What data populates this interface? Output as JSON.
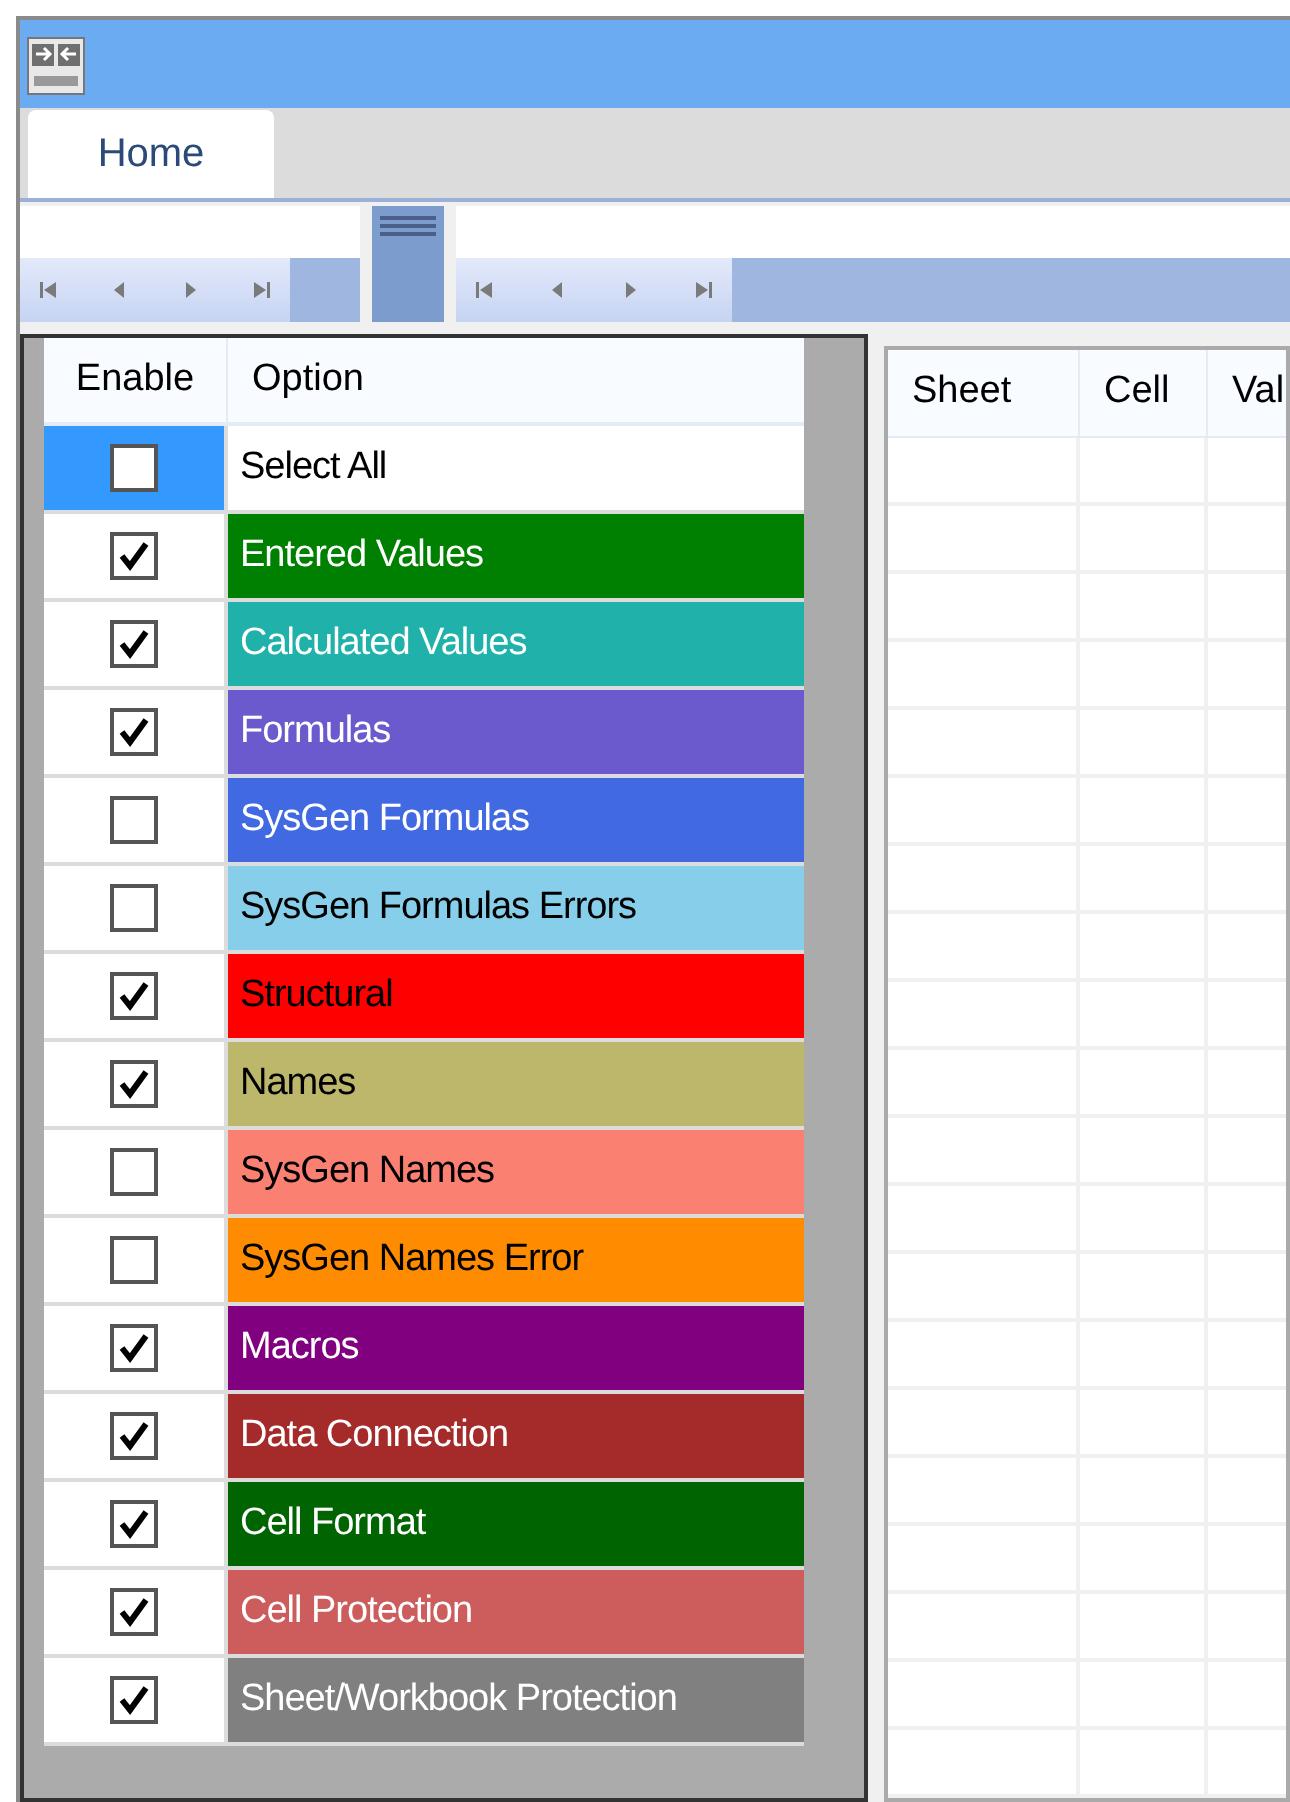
{
  "tabs": [
    {
      "label": "Home",
      "selected": true
    }
  ],
  "options_table": {
    "columns": [
      "Enable",
      "Option"
    ],
    "rows": [
      {
        "label": "Select All",
        "checked": false,
        "selected": true,
        "color": "#ffffff",
        "dark_text": true
      },
      {
        "label": "Entered Values",
        "checked": true,
        "selected": false,
        "color": "#008000",
        "dark_text": false
      },
      {
        "label": "Calculated Values",
        "checked": true,
        "selected": false,
        "color": "#20b2aa",
        "dark_text": false
      },
      {
        "label": "Formulas",
        "checked": true,
        "selected": false,
        "color": "#6a5acd",
        "dark_text": false
      },
      {
        "label": "SysGen Formulas",
        "checked": false,
        "selected": false,
        "color": "#4169e1",
        "dark_text": false
      },
      {
        "label": "SysGen Formulas Errors",
        "checked": false,
        "selected": false,
        "color": "#87ceeb",
        "dark_text": true
      },
      {
        "label": "Structural",
        "checked": true,
        "selected": false,
        "color": "#ff0000",
        "dark_text": true
      },
      {
        "label": "Names",
        "checked": true,
        "selected": false,
        "color": "#bdb76b",
        "dark_text": true
      },
      {
        "label": "SysGen Names",
        "checked": false,
        "selected": false,
        "color": "#fa8072",
        "dark_text": true
      },
      {
        "label": "SysGen Names Error",
        "checked": false,
        "selected": false,
        "color": "#ff8c00",
        "dark_text": true
      },
      {
        "label": "Macros",
        "checked": true,
        "selected": false,
        "color": "#800080",
        "dark_text": false
      },
      {
        "label": "Data Connection",
        "checked": true,
        "selected": false,
        "color": "#a52a2a",
        "dark_text": false
      },
      {
        "label": "Cell Format",
        "checked": true,
        "selected": false,
        "color": "#006400",
        "dark_text": false
      },
      {
        "label": "Cell Protection",
        "checked": true,
        "selected": false,
        "color": "#cd5c5c",
        "dark_text": false
      },
      {
        "label": "Sheet/Workbook Protection",
        "checked": true,
        "selected": false,
        "color": "#808080",
        "dark_text": false
      }
    ]
  },
  "results_table": {
    "columns": [
      "Sheet",
      "Cell",
      "Val"
    ]
  }
}
